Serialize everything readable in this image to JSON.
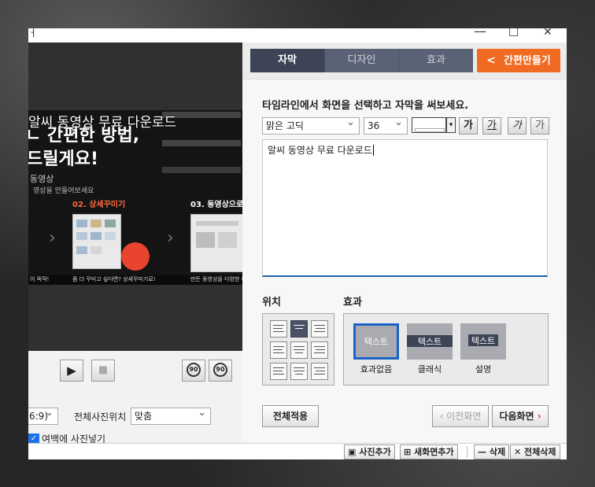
{
  "window": {
    "title_fragment": "ㅓ",
    "minimize_glyph": "—",
    "maximize_glyph": "□",
    "close_glyph": "✕"
  },
  "preview": {
    "caption_overlay": "알씨 동영상 무료 다운로드",
    "headline_line1": "ㄴ 간편한 방법,",
    "headline_line2": "드릴게요!",
    "subtitle": "동영상",
    "subnote": "영상을 만들어보세요",
    "step2": "02. 상세꾸미기",
    "step3": "03. 동영상으로 저",
    "strip": [
      "이 뚝딱!",
      "좀 더 꾸미고 싶다면? 상세꾸미기로!",
      "만든 동영상을 다양한 파"
    ]
  },
  "controls": {
    "play": "▶",
    "stop": "■",
    "rotate_left": "90",
    "rotate_right": "90"
  },
  "left_options": {
    "ratio_value": "6:9)",
    "full_photo_position_label": "전체사진위치",
    "full_photo_position_value": "맞춤",
    "margin_checkbox_label": "여백에 사진넣기",
    "checkbox_checked": true
  },
  "tabs": [
    {
      "label": "자막",
      "active": true
    },
    {
      "label": "디자인",
      "active": false
    },
    {
      "label": "효과",
      "active": false
    }
  ],
  "quick_make_button": "간편만들기",
  "quick_make_icon": "chevron-left-icon",
  "subtitle_panel": {
    "instruction": "타임라인에서 화면을 선택하고 자막을 써보세요.",
    "font_name": "맑은 고딕",
    "font_size": "36",
    "text_color": "#ffffff",
    "style_buttons": [
      "가",
      "가",
      "가",
      "가"
    ],
    "text_value": "알씨 동영상 무료 다운로드"
  },
  "position_label": "위치",
  "effect_label": "효과",
  "position_selected": 1,
  "effects": [
    {
      "preview_text": "텍스트",
      "label": "효과없음",
      "selected": true
    },
    {
      "preview_text": "텍스트",
      "label": "클래식",
      "selected": false
    },
    {
      "preview_text": "텍스트",
      "label": "설명",
      "selected": false
    }
  ],
  "buttons": {
    "apply_all": "전체적용",
    "prev_screen": "이전화면",
    "next_screen": "다음화면"
  },
  "bottom_bar": {
    "add_photo": "사진추가",
    "add_new_screen": "새화면추가",
    "delete": "삭제",
    "delete_all": "전체삭제"
  }
}
